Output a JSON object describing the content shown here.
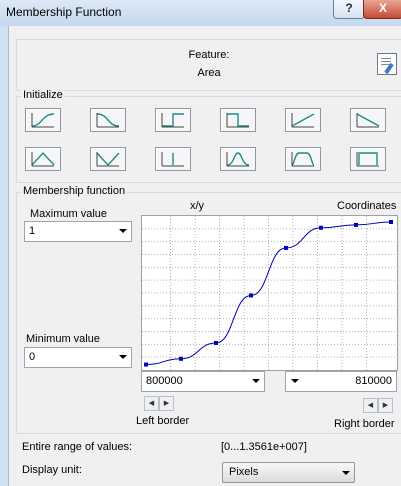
{
  "window": {
    "title": "Membership Function",
    "help_label": "?",
    "close_label": "X"
  },
  "feature": {
    "label": "Feature:",
    "value": "Area",
    "properties_icon": "properties-icon"
  },
  "initialize": {
    "caption": "Initialize",
    "shapes": [
      "s-curve-rising-icon",
      "s-curve-falling-icon",
      "step-rising-icon",
      "step-falling-icon",
      "linear-rising-icon",
      "linear-falling-icon",
      "triangle-icon",
      "inverted-triangle-icon",
      "singleton-icon",
      "gaussian-icon",
      "trapezoid-icon",
      "rectangle-icon"
    ]
  },
  "membership": {
    "caption": "Membership function",
    "xy_label": "x/y",
    "coordinates_label": "Coordinates",
    "max_label": "Maximum value",
    "max_value": "1",
    "min_label": "Minimum value",
    "min_value": "0",
    "left_border_value": "800000",
    "right_border_value": "810000",
    "left_border_label": "Left border",
    "right_border_label": "Right border",
    "curve_y": [
      0.01,
      0.05,
      0.16,
      0.49,
      0.82,
      0.96,
      0.98,
      1.0
    ],
    "curve_color": "#0000b8"
  },
  "range": {
    "label": "Entire range of values:",
    "value": "[0...1.3561e+007]"
  },
  "display": {
    "label": "Display unit:",
    "value": "Pixels"
  }
}
